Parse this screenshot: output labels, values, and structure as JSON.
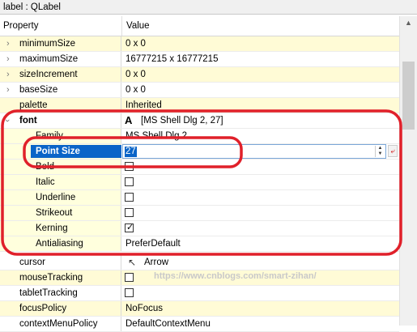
{
  "window": {
    "title": "label : QLabel"
  },
  "header": {
    "property": "Property",
    "value": "Value"
  },
  "rows": [
    {
      "name": "minimumSize",
      "value": "0 x 0"
    },
    {
      "name": "maximumSize",
      "value": "16777215 x 16777215"
    },
    {
      "name": "sizeIncrement",
      "value": "0 x 0"
    },
    {
      "name": "baseSize",
      "value": "0 x 0"
    },
    {
      "name": "palette",
      "value": "Inherited"
    }
  ],
  "font": {
    "name": "font",
    "value": "[MS Shell Dlg 2, 27]",
    "icon": "font-A-icon",
    "family": {
      "name": "Family",
      "value": "MS Shell Dlg 2"
    },
    "point_size": {
      "name": "Point Size",
      "value": "27"
    },
    "bold": {
      "name": "Bold",
      "checked": false
    },
    "italic": {
      "name": "Italic",
      "checked": false
    },
    "underline": {
      "name": "Underline",
      "checked": false
    },
    "strikeout": {
      "name": "Strikeout",
      "checked": false
    },
    "kerning": {
      "name": "Kerning",
      "checked": true
    },
    "antialiasing": {
      "name": "Antialiasing",
      "value": "PreferDefault"
    }
  },
  "after_rows": {
    "cursor": {
      "name": "cursor",
      "value": "Arrow"
    },
    "mouseTracking": {
      "name": "mouseTracking",
      "checked": false
    },
    "tabletTracking": {
      "name": "tabletTracking",
      "checked": false
    },
    "focusPolicy": {
      "name": "focusPolicy",
      "value": "NoFocus"
    },
    "contextMenuPolicy": {
      "name": "contextMenuPolicy",
      "value": "DefaultContextMenu"
    }
  },
  "watermark": "https://www.cnblogs.com/smart-zihan/",
  "colors": {
    "annotation_red": "#e0202a",
    "selection_blue": "#0a64c8",
    "row_yellow": "#fffbd6"
  }
}
